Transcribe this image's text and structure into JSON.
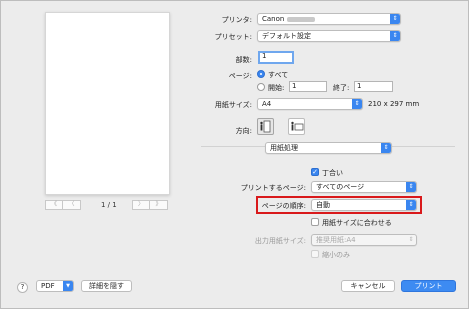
{
  "printer": {
    "label": "プリンタ:",
    "value": "Canon"
  },
  "preset": {
    "label": "プリセット:",
    "value": "デフォルト設定"
  },
  "copies": {
    "label": "部数:",
    "value": "1"
  },
  "pages": {
    "label": "ページ:",
    "all_label": "すべて",
    "from_label": "開始:",
    "from_value": "1",
    "to_label": "終了:",
    "to_value": "1"
  },
  "paper_size": {
    "label": "用紙サイズ:",
    "value": "A4",
    "dimensions": "210 x 297 mm"
  },
  "orientation": {
    "label": "方向:"
  },
  "section_menu": {
    "value": "用紙処理"
  },
  "collate": {
    "label": "丁合い",
    "checked": true
  },
  "pages_to_print": {
    "label": "プリントするページ:",
    "value": "すべてのページ"
  },
  "page_order": {
    "label": "ページの順序:",
    "value": "自動"
  },
  "scale_to_fit": {
    "label": "用紙サイズに合わせる",
    "checked": false
  },
  "dest_paper": {
    "label": "出力用紙サイズ:",
    "value": "推奨用紙:A4"
  },
  "scale_down_only": {
    "label": "縮小のみ"
  },
  "preview_pager": {
    "indicator": "1 / 1",
    "first": "《",
    "prev": "〈",
    "next": "〉",
    "last": "》"
  },
  "footer": {
    "help": "?",
    "pdf_label": "PDF",
    "hide_details": "詳細を隠す",
    "cancel": "キャンセル",
    "print": "プリント"
  },
  "colors": {
    "accent": "#3a86f0",
    "highlight": "#d9191b"
  }
}
